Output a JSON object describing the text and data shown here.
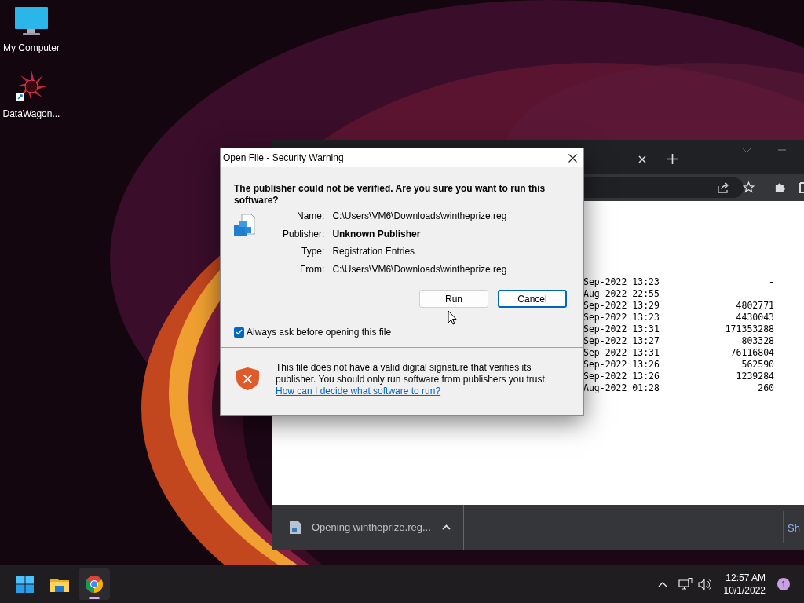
{
  "desktop_icons": [
    {
      "kind": "monitor",
      "label": "My Computer"
    },
    {
      "kind": "shortcut",
      "label": "DataWagon..."
    }
  ],
  "browser": {
    "listing_rows": [
      {
        "modified": "Sep-2022 13:23",
        "size": "-"
      },
      {
        "modified": "Aug-2022 22:55",
        "size": "-"
      },
      {
        "modified": "Sep-2022 13:29",
        "size": "4802771"
      },
      {
        "modified": "Sep-2022 13:23",
        "size": "4430043"
      },
      {
        "modified": "Sep-2022 13:31",
        "size": "171353288"
      },
      {
        "modified": "Sep-2022 13:27",
        "size": "803328"
      },
      {
        "modified": "Sep-2022 13:31",
        "size": "76116804"
      },
      {
        "modified": "Sep-2022 13:26",
        "size": "562590"
      },
      {
        "modified": "Sep-2022 13:26",
        "size": "1239284"
      },
      {
        "modified": "Aug-2022 01:28",
        "size": "260"
      }
    ],
    "download": {
      "label": "Opening wintheprize.reg..."
    },
    "show_all": "Sh"
  },
  "dialog": {
    "title": "Open File - Security Warning",
    "heading": "The publisher could not be verified.  Are you sure you want to run this software?",
    "fields": [
      {
        "label": "Name:",
        "value": "C:\\Users\\VM6\\Downloads\\wintheprize.reg",
        "bold": false
      },
      {
        "label": "Publisher:",
        "value": "Unknown Publisher",
        "bold": true
      },
      {
        "label": "Type:",
        "value": "Registration Entries",
        "bold": false
      },
      {
        "label": "From:",
        "value": "C:\\Users\\VM6\\Downloads\\wintheprize.reg",
        "bold": false
      }
    ],
    "buttons": [
      {
        "label": "Run",
        "focused": false
      },
      {
        "label": "Cancel",
        "focused": true
      }
    ],
    "checkbox": {
      "label": "Always ask before opening this file",
      "checked": true
    },
    "warning": "This file does not have a valid digital signature that verifies its publisher.  You should only run software from publishers you trust.",
    "link": "How can I decide what software to run?"
  },
  "taskbar": {
    "apps": [
      {
        "kind": "start",
        "active": false
      },
      {
        "kind": "folder",
        "active": false
      },
      {
        "kind": "chrome",
        "active": true
      }
    ],
    "time": "12:57 AM",
    "date": "10/1/2022",
    "notifications": "1"
  }
}
